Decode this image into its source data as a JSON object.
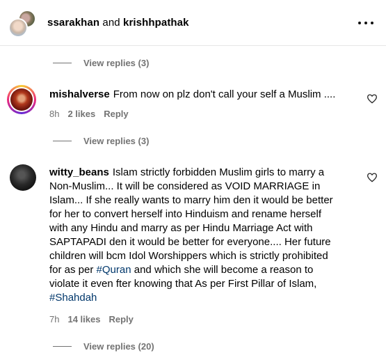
{
  "header": {
    "user1": "ssarakhan",
    "and": " and ",
    "user2": "krishhpathak"
  },
  "view_replies_top": "View replies (3)",
  "comments": [
    {
      "username": "mishalverse",
      "text": "From now on plz don't call your self a Muslim ....",
      "time": "8h",
      "likes": "2 likes",
      "reply": "Reply",
      "view_replies": "View replies (3)"
    },
    {
      "username": "witty_beans",
      "text_lines": [
        "Islam strictly forbidden Muslim girls to marry a",
        "Non-Muslim... It will be considered as VOID MARRIAGE in",
        "Islam... If she really wants to marry him den it would be better",
        "for her to convert herself into Hinduism and rename herself",
        "with any Hindu and marry as per Hindu Marriage Act with",
        "SAPTAPADI den it would be better for everyone.... Her future",
        "children will bcm Idol Worshippers which is strictly prohibited"
      ],
      "line8_pre": "for as per ",
      "tag1": "#Quran",
      "line8_post": " and which she will become a reason to",
      "line9": "violate it even fter knowing that As per First Pillar of Islam,",
      "tag2": "#Shahdah",
      "time": "7h",
      "likes": "14 likes",
      "reply": "Reply",
      "view_replies": "View replies (20)"
    }
  ],
  "icons": {
    "more": "more-options-icon",
    "like": "heart-icon"
  },
  "colors": {
    "secondary_text": "#737373",
    "hashtag": "#00376b",
    "divider": "#e6e6e6"
  }
}
